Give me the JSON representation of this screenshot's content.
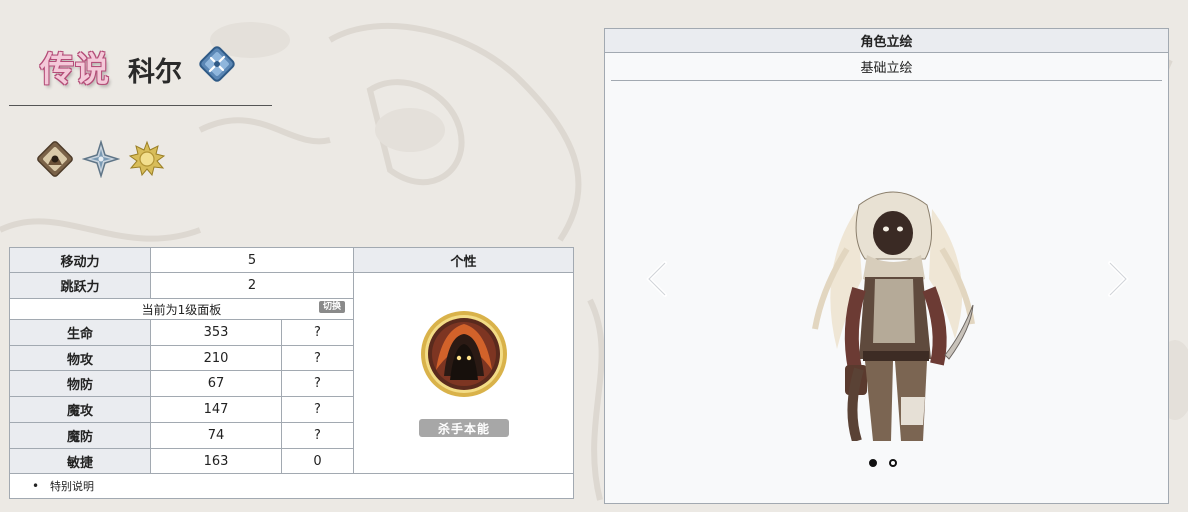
{
  "header": {
    "rarity": "传说",
    "character_name": "科尔",
    "class_icon": "assassin-class-icon",
    "trait_icons": [
      "hooded-figure-icon",
      "shuriken-icon",
      "sun-icon"
    ]
  },
  "stats": {
    "movement_label": "移动力",
    "movement_value": "5",
    "jump_label": "跳跃力",
    "jump_value": "2",
    "panel_level_text": "当前为1级面板",
    "switch_label": "切换",
    "rows": [
      {
        "label": "生命",
        "value": "353",
        "extra": "?"
      },
      {
        "label": "物攻",
        "value": "210",
        "extra": "?"
      },
      {
        "label": "物防",
        "value": "67",
        "extra": "?"
      },
      {
        "label": "魔攻",
        "value": "147",
        "extra": "?"
      },
      {
        "label": "魔防",
        "value": "74",
        "extra": "?"
      },
      {
        "label": "敏捷",
        "value": "163",
        "extra": "0"
      }
    ],
    "personality_header": "个性",
    "skill_name": "杀手本能",
    "note": "特别说明"
  },
  "artwork": {
    "title": "角色立绘",
    "subtitle": "基础立绘",
    "slide_count": 2,
    "active_slide": 0
  },
  "colors": {
    "table_header_bg": "#eaecf0",
    "border": "#a2a9b1",
    "rarity_pink": "#f4c9d9"
  }
}
